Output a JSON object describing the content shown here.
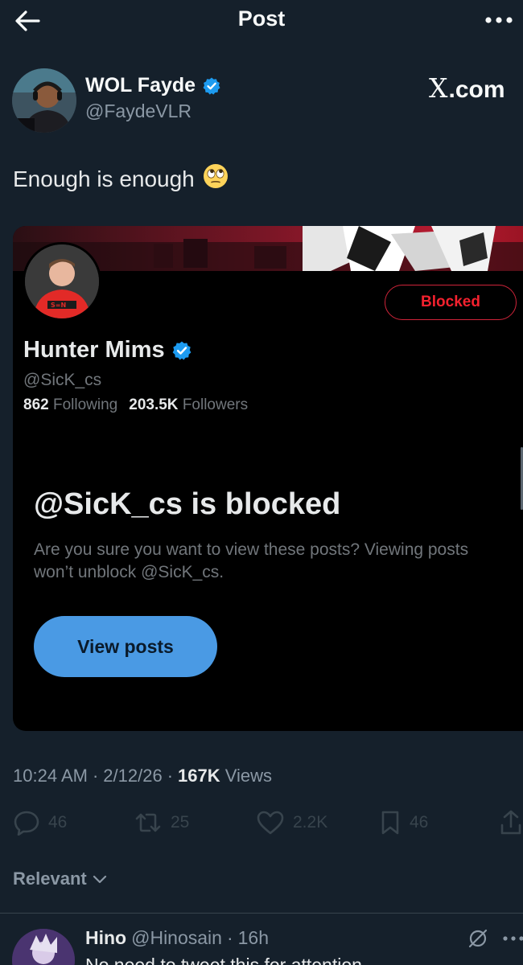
{
  "header": {
    "title": "Post",
    "back_icon": "back-arrow-icon",
    "more_icon": "more-dots-icon"
  },
  "author": {
    "name": "WOL Fayde",
    "handle": "@FaydeVLR",
    "verified": true,
    "watermark": ".com",
    "watermark_logo": "X"
  },
  "post": {
    "text": "Enough is enough",
    "emoji": "🙄"
  },
  "embed": {
    "name": "Hunter Mims",
    "handle": "@SicK_cs",
    "verified": true,
    "blocked_label": "Blocked",
    "following_count": "862",
    "following_label": "Following",
    "followers_count": "203.5K",
    "followers_label": "Followers",
    "blocked_title": "@SicK_cs is blocked",
    "blocked_description": "Are you sure you want to view these posts? Viewing posts won’t unblock @SicK_cs.",
    "view_posts_label": "View posts"
  },
  "meta": {
    "time": "10:24 AM",
    "date": "2/12/26",
    "views_count": "167K",
    "views_label": "Views"
  },
  "actions": {
    "replies": "46",
    "reposts": "25",
    "likes": "2.2K",
    "bookmarks": "46"
  },
  "sort": {
    "label": "Relevant"
  },
  "reply": {
    "name": "Hino",
    "handle": "@Hinosain",
    "time": "16h",
    "text": "No need to tweet this for attention"
  },
  "colors": {
    "background": "#15202b",
    "accent": "#4a9ae4",
    "blocked_red": "#f4212e",
    "verified_blue": "#1d9bf0"
  }
}
